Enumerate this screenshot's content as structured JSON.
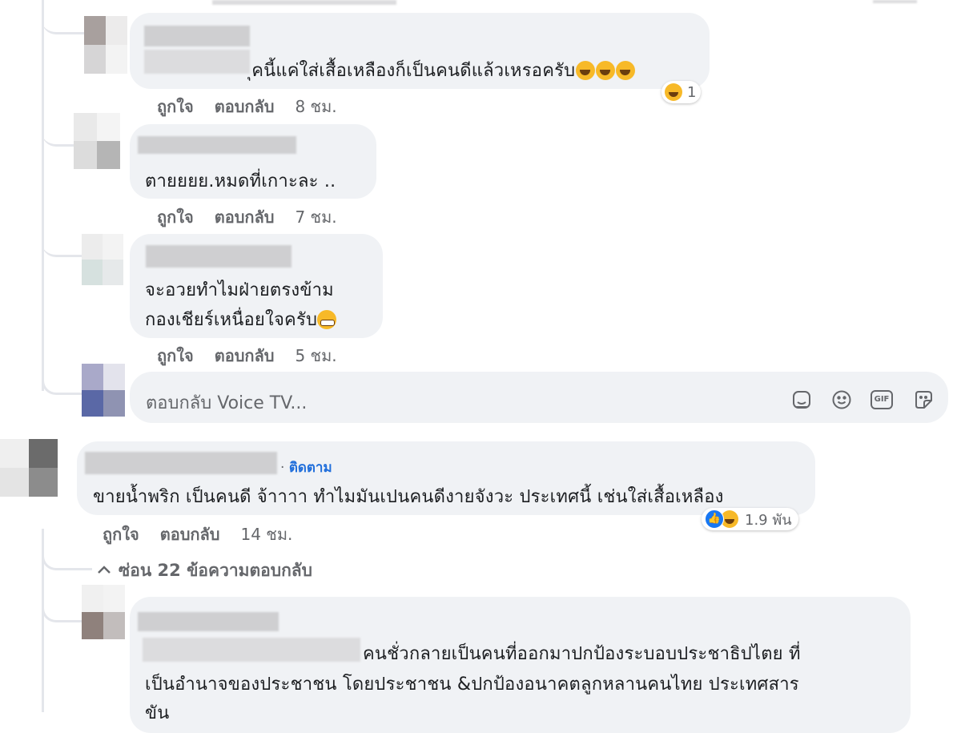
{
  "comments": [
    {
      "text": "ุคนี้แค่ใส่เสื้อเหลืองก็เป็นคนดีแล้วเหรอครับ",
      "reaction_count": "1",
      "actions": {
        "like": "ถูกใจ",
        "reply": "ตอบกลับ",
        "time": "8 ชม."
      }
    },
    {
      "text": "ตายยยย.หมดที่เกาะละ ..",
      "actions": {
        "like": "ถูกใจ",
        "reply": "ตอบกลับ",
        "time": "7 ชม."
      }
    },
    {
      "text_line1": "จะอวยทำไมฝ่ายตรงข้าม",
      "text_line2": "กองเชียร์เหนื่อยใจครับ",
      "actions": {
        "like": "ถูกใจ",
        "reply": "ตอบกลับ",
        "time": "5 ชม."
      }
    }
  ],
  "reply_box": {
    "placeholder": "ตอบกลับ Voice TV...",
    "icons": [
      "sticker-face-icon",
      "emoji-icon",
      "gif-icon",
      "sticker-icon"
    ],
    "gif_label": "GIF"
  },
  "main_comment": {
    "follow_prefix": "·",
    "follow_label": "ติดตาม",
    "text": "ขายน้ำพริก เป็นคนดี จ้าาาา ทำไมมันเปนคนดีงายจังวะ ประเทศนี้ เช่นใส่เสื้อเหลือง",
    "reaction_count": "1.9 พัน",
    "actions": {
      "like": "ถูกใจ",
      "reply": "ตอบกลับ",
      "time": "14 ชม."
    },
    "hide_replies": "ซ่อน 22 ข้อความตอบกลับ"
  },
  "bottom_comment": {
    "line1": "คนชั่วกลายเป็นคนที่ออกมาปกป้องระบอบประชาธิปไตย ที่",
    "line2": "เป็นอำนาจของประชาชน โดยประชาชน &ปกป้องอนาคตลูกหลานคนไทย ประเทศสาร",
    "line3": "ขัน"
  },
  "colors": {
    "bubble": "#f0f2f5",
    "meta_text": "#65676b",
    "link": "#216fdb",
    "like_blue": "#1877f2",
    "emoji_yellow": "#f7b928"
  }
}
